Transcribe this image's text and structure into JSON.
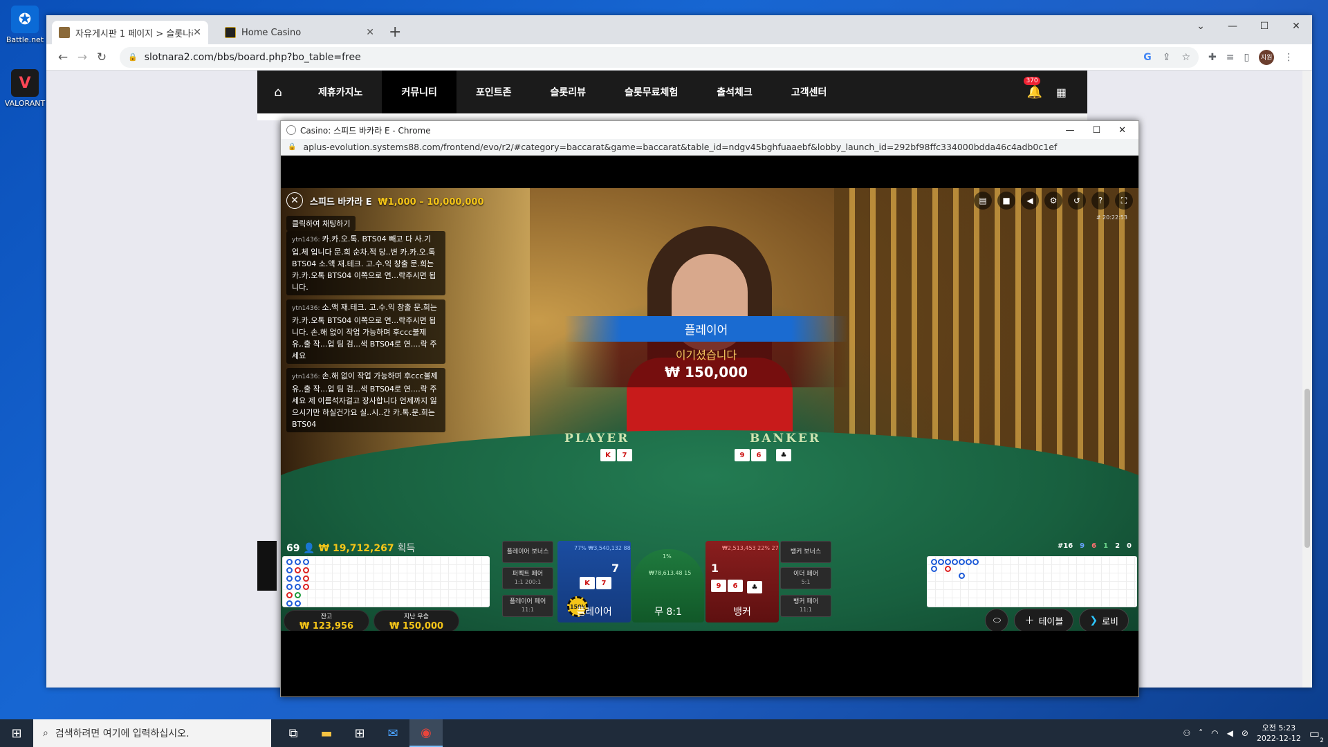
{
  "desktop": {
    "icons": [
      {
        "label": "Battle.net",
        "icon": "battlenet-icon"
      },
      {
        "label": "VALORANT",
        "icon": "valorant-icon"
      }
    ]
  },
  "browser": {
    "tabs": [
      {
        "title": "자유게시판 1 페이지 > 슬롯나라",
        "active": true
      },
      {
        "title": "Home Casino",
        "active": false
      }
    ],
    "url": "slotnara2.com/bbs/board.php?bo_table=free",
    "profile_initials": "지원"
  },
  "site": {
    "nav": [
      "제휴카지노",
      "커뮤니티",
      "포인트존",
      "슬롯리뷰",
      "슬롯무료체험",
      "출석체크",
      "고객센터"
    ],
    "active_nav": "커뮤니티",
    "bell_count": "370",
    "chat_button_count": "370"
  },
  "popup": {
    "window_title": "Casino: 스피드 바카라 E - Chrome",
    "url": "aplus-evolution.systems88.com/frontend/evo/r2/#category=baccarat&game=baccarat&table_id=ndgv45bghfuaaebf&lobby_launch_id=292bf98ffc334000bdda46c4adb0c1ef"
  },
  "game": {
    "table_name": "스피드 바카라 E",
    "limits": "₩1,000 – 10,000,000",
    "time": "# 20:22:53",
    "chat_toggle": "클릭하여 채팅하기",
    "chat": [
      {
        "user": "ytn1436:",
        "text": "카.카.오.톡. BTS04 빼고 다 사.기업.체 입니다 문.희 순차.적 당..변 카.카.오.톡 BTS04 소.액 재.테크. 고.수.익 창출 문.희는 카.카.오톡 BTS04 이쪽으로 연...락주시면 됩니다."
      },
      {
        "user": "ytn1436:",
        "text": "소.액 재.테크. 고.수.익 창출 문.희는 카.카.오톡 BTS04 이쪽으로 연...락주시면 됩니다. 손.해 없이 작업 가능하며 후ccc불제 유,.출 작...업 팀 검...색 BTS04로 연....락 주세요"
      },
      {
        "user": "ytn1436:",
        "text": "손.해 없이 작업 가능하며 후ccc불제 유,.출 작...업 팀 검...색 BTS04로 연....락 주세요 제 이름석자걸고 장사합니다 언제까지 잃으시기만 하실건가요 실..시..간 카.톡.문.희는 BTS04"
      }
    ],
    "win_banner": {
      "side": "플레이어",
      "message": "이기셨습니다",
      "amount": "₩ 150,000"
    },
    "table_labels": {
      "player": "PLAYER",
      "banker": "BANKER"
    },
    "players_online": "69",
    "total_won": "₩ 19,712,267",
    "total_won_label": "획득",
    "stats": [
      "#16",
      "9",
      "6",
      "1",
      "2",
      "0"
    ],
    "bets": {
      "player_bonus": "플레이어 보너스",
      "perfect_pair": "퍼펙트 페어",
      "perfect_pair_odds": "1:1 200:1",
      "player_pair": "플레이어 페어",
      "player_pair_odds": "11:1",
      "banker_bonus": "뱅커 보너스",
      "either_pair": "이더 페어",
      "either_pair_odds": "5:1",
      "banker_pair": "뱅커 페어",
      "banker_pair_odds": "11:1",
      "player_label": "플레이어",
      "player_score": "7",
      "player_pct": "77%",
      "player_amount": "₩3,540,132",
      "player_count": "88",
      "player_chip": "150k",
      "tie_label": "무 8:1",
      "tie_pct": "1%",
      "tie_amount": "₩78,613.48",
      "tie_count": "15",
      "banker_label": "뱅커",
      "banker_score": "1",
      "banker_pct": "22%",
      "banker_amount": "₩2,513,453",
      "banker_count": "27"
    },
    "balance": {
      "label": "잔고",
      "value": "₩ 123,956"
    },
    "last_win": {
      "label": "지난 우승",
      "value": "₩ 150,000"
    },
    "buttons": {
      "table": "테이블",
      "lobby": "로비"
    }
  },
  "taskbar": {
    "search_placeholder": "검색하려면 여기에 입력하십시오.",
    "time": "오전 5:23",
    "date": "2022-12-12",
    "notifications": "2"
  }
}
